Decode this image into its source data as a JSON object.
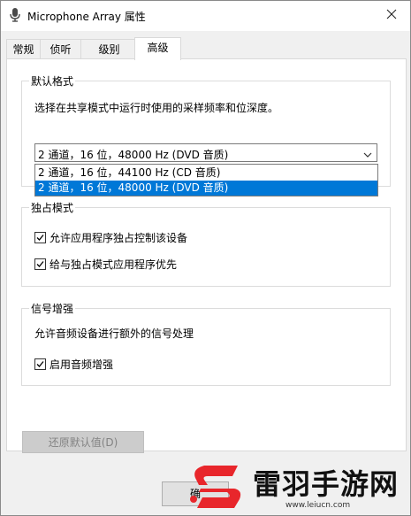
{
  "window": {
    "title": "Microphone Array 属性"
  },
  "tabs": [
    {
      "label": "常规"
    },
    {
      "label": "侦听"
    },
    {
      "label": "级别"
    },
    {
      "label": "高级",
      "active": true
    }
  ],
  "default_format": {
    "legend": "默认格式",
    "description": "选择在共享模式中运行时使用的采样频率和位深度。",
    "selected": "2 通道，16 位，48000 Hz (DVD 音质)",
    "options": [
      "2 通道，16 位，44100 Hz (CD 音质)",
      "2 通道，16 位，48000 Hz (DVD 音质)"
    ]
  },
  "exclusive_mode": {
    "legend": "独占模式",
    "allow_exclusive": {
      "label": "允许应用程序独占控制该设备",
      "checked": true
    },
    "give_priority": {
      "label": "给与独占模式应用程序优先",
      "checked": true
    }
  },
  "signal_enhancement": {
    "legend": "信号增强",
    "description": "允许音频设备进行额外的信号处理",
    "enable_enhancement": {
      "label": "启用音频增强",
      "checked": true
    }
  },
  "buttons": {
    "restore_defaults": "还原默认值(D)",
    "ok": "确"
  },
  "watermark": {
    "brand": "雷羽手游网",
    "url": "www.leiucn.com"
  },
  "colors": {
    "accent": "#0078d7",
    "watermark_red": "#e8262b"
  }
}
